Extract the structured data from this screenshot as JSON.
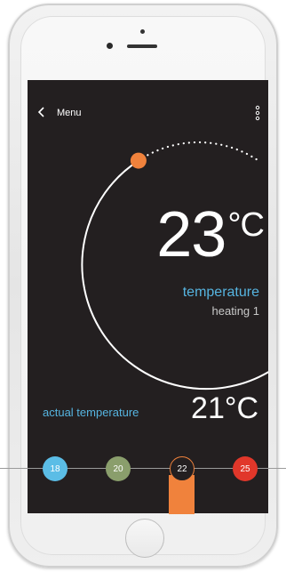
{
  "header": {
    "back_icon": "chevron-left-icon",
    "title": "Menu",
    "more_icon": "more-vertical-icon"
  },
  "thermostat": {
    "setpoint_value": "23",
    "setpoint_unit": "°C",
    "mode_label": "temperature",
    "zone_label": "heating 1",
    "accent_color": "#f0823c"
  },
  "actual": {
    "label": "actual temperature",
    "value": "21°C"
  },
  "presets": [
    {
      "label": "18",
      "color": "#5bbde6",
      "selected": false
    },
    {
      "label": "20",
      "color": "#8a9e6c",
      "selected": false
    },
    {
      "label": "22",
      "color": "#231f20",
      "selected": true
    },
    {
      "label": "25",
      "color": "#e1372a",
      "selected": false
    }
  ],
  "device": {
    "home_button": "home-button"
  }
}
